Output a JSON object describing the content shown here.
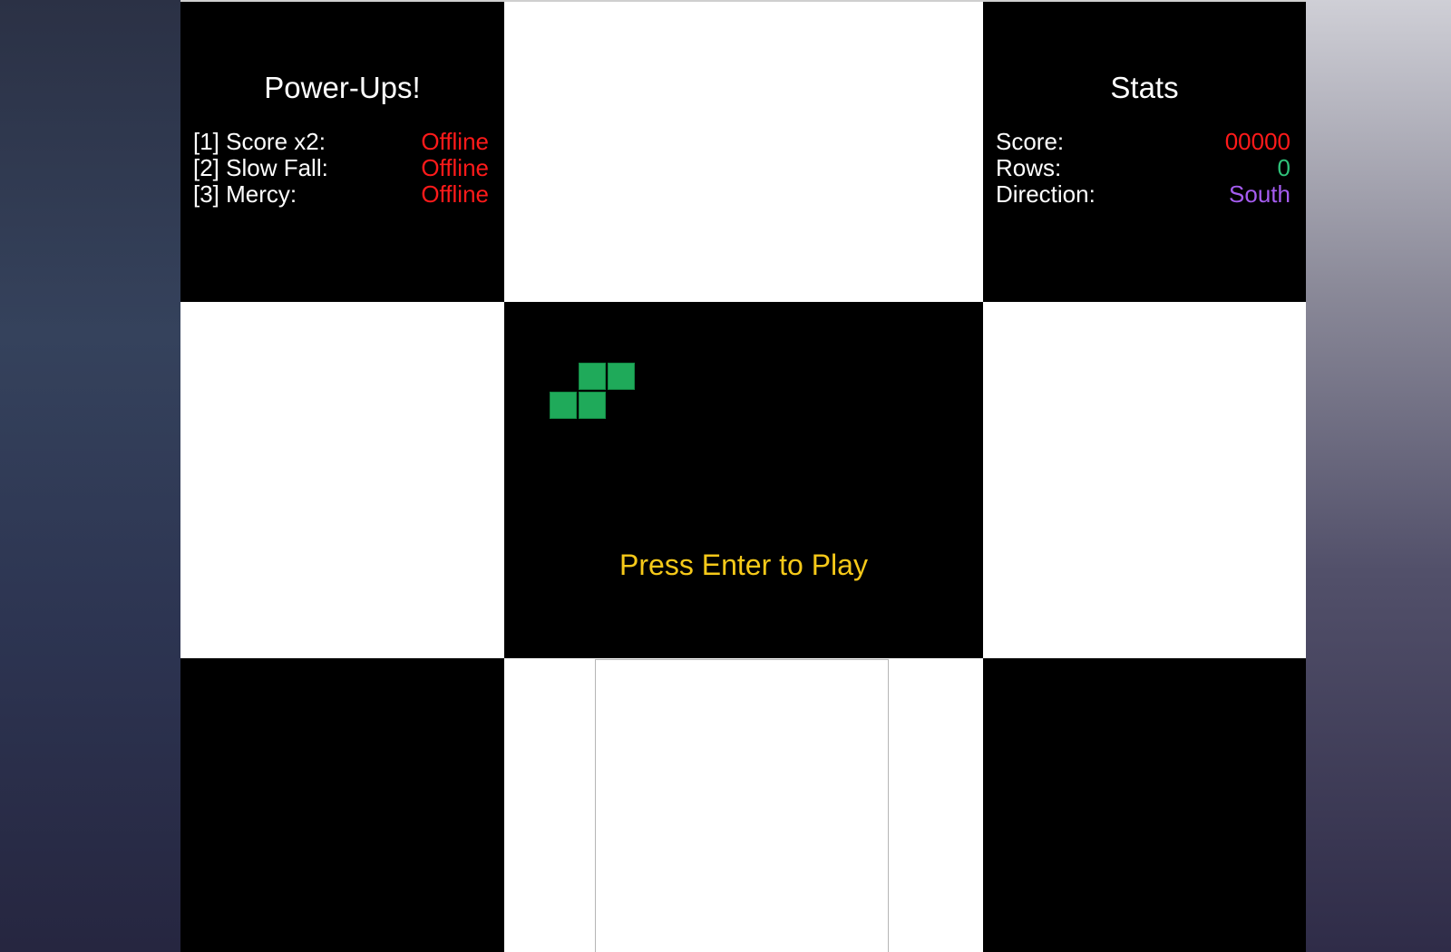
{
  "powerups": {
    "title": "Power-Ups!",
    "items": [
      {
        "label": "[1] Score x2:",
        "status": "Offline"
      },
      {
        "label": "[2] Slow Fall:",
        "status": "Offline"
      },
      {
        "label": "[3] Mercy:",
        "status": "Offline"
      }
    ]
  },
  "stats": {
    "title": "Stats",
    "items": [
      {
        "label": "Score:",
        "value": "00000"
      },
      {
        "label": "Rows:",
        "value": "0"
      },
      {
        "label": "Direction:",
        "value": "South"
      }
    ]
  },
  "game": {
    "prompt": "Press Enter to Play",
    "piece": "S-tetromino",
    "piece_color": "#1faa5a"
  },
  "colors": {
    "offline": "#ff1a1a",
    "score": "#ff1a1a",
    "rows": "#2fc27a",
    "direction": "#a55cf0",
    "prompt": "#f6c919"
  }
}
